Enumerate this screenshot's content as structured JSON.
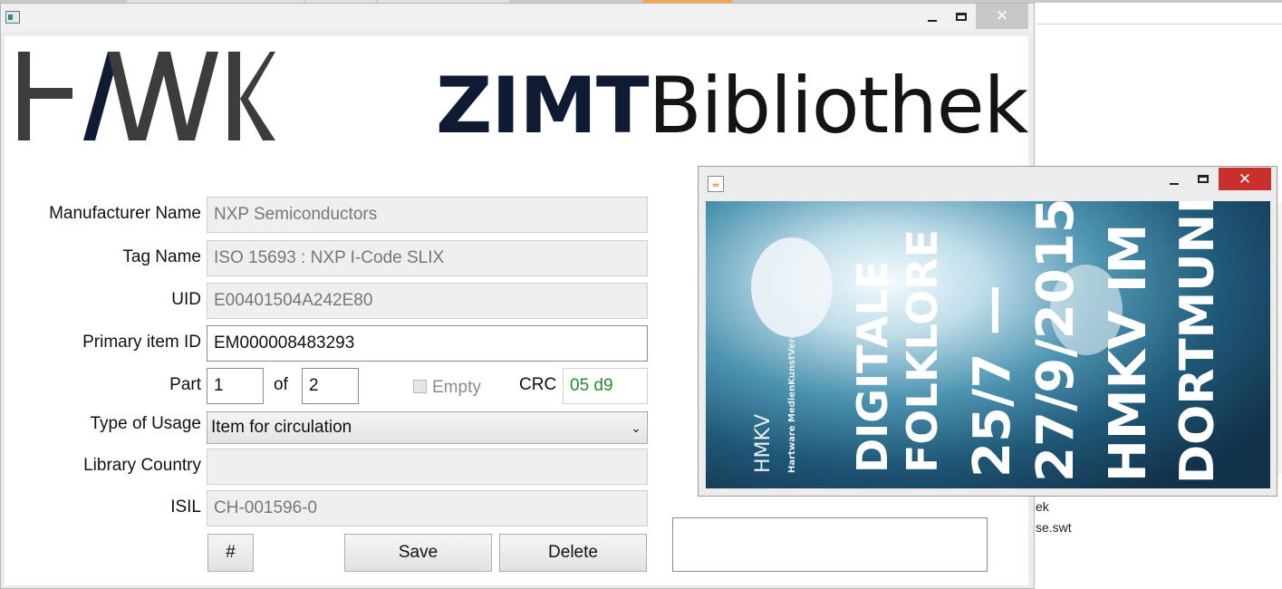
{
  "main_window": {
    "close_glyph": "✕"
  },
  "branding": {
    "logo_left": "HAWK",
    "logo_right_bold": "ZIMT",
    "logo_right_light": "Bibliothek"
  },
  "form": {
    "manufacturer_label": "Manufacturer Name",
    "manufacturer_value": "NXP Semiconductors",
    "tag_label": "Tag Name",
    "tag_value": "ISO 15693 : NXP I-Code SLIX",
    "uid_label": "UID",
    "uid_value": "E00401504A242E80",
    "primary_label": "Primary item ID",
    "primary_value": "EM000008483293",
    "part_label": "Part",
    "part_value": "1",
    "of_label": "of",
    "of_value": "2",
    "empty_label": "Empty",
    "crc_label": "CRC",
    "crc_value": "05 d9",
    "usage_label": "Type of Usage",
    "usage_value": "Item for circulation",
    "country_label": "Library Country",
    "country_value": "",
    "isil_label": "ISIL",
    "isil_value": "CH-001596-0",
    "hash_button": "#",
    "save_button": "Save",
    "delete_button": "Delete"
  },
  "camera_window": {
    "close_glyph": "✕",
    "java_icon": "☕",
    "poster_lines": [
      "DIGITALE",
      "FOLKLORE",
      "25/7 —",
      "27/9/2015",
      "HMKV IM",
      "DORTMUNDER U"
    ],
    "poster_small": [
      "HMKV",
      "Hartware MedienKunstVerein"
    ]
  },
  "background": {
    "text_1": "ek",
    "text_2": "se.swt"
  },
  "colors": {
    "crc_text": "#2b8a2b",
    "close_button_red": "#c9302c",
    "logo_dark": "#0f1b33"
  }
}
